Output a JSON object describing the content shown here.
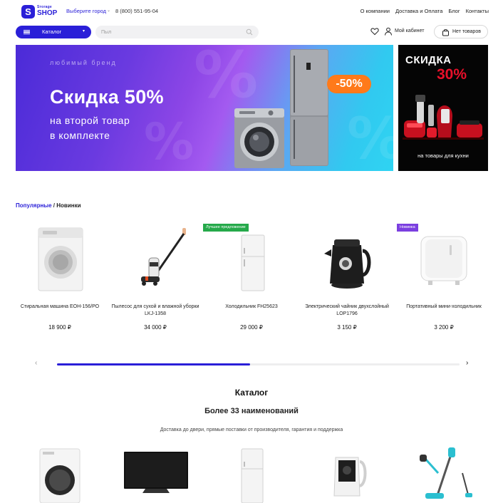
{
  "header": {
    "logo_top": "Sтorage",
    "logo_bottom": "SHOP",
    "logo_badge": "S",
    "city": "Выберите город",
    "phone": "8 (800) 551-95-04",
    "nav": [
      "О компании",
      "Доставка и Оплата",
      "Блог",
      "Контакты"
    ]
  },
  "search": {
    "catalog_label": "Каталог",
    "placeholder": "Пыл",
    "cabinet_label": "Мой кабинет",
    "cart_label": "Нет товаров"
  },
  "banner_main": {
    "brand": "любимый бренд",
    "headline": "Скидка 50%",
    "line1": "на второй товар",
    "line2": "в комплекте",
    "discount": "-50%",
    "bg_symbol": "%"
  },
  "banner_side": {
    "title": "СКИДКА",
    "percent": "30%",
    "footer": "на товары для кухни"
  },
  "tabs": {
    "popular": "Популярные",
    "separator": " / ",
    "new": "Новинки"
  },
  "products": [
    {
      "name": "Стиральная машина ЕОН-156/РО",
      "price": "18 900 ₽",
      "badge": ""
    },
    {
      "name": "Пылесос для сухой и влажной уборки LKJ-1358",
      "price": "34 000 ₽",
      "badge": ""
    },
    {
      "name": "Холодильник FH25623",
      "price": "29 000 ₽",
      "badge": "Лучшее предложение"
    },
    {
      "name": "Электрический чайник двухслойный LOP1796",
      "price": "3 150 ₽",
      "badge": ""
    },
    {
      "name": "Портативный мини-холодильник",
      "price": "3 200 ₽",
      "badge": "Новинка"
    }
  ],
  "slider": {
    "progress": 0.48
  },
  "catalog": {
    "title": "Каталог",
    "subtitle": "Более 33 наименований",
    "description": "Доставка до двери, прямые поставки от производителя, гарантия и поддержка"
  },
  "colors": {
    "accent": "#2a1fd8",
    "badge_best": "#25a94a",
    "badge_new": "#7b3fe0",
    "sale_orange": "#ff7a1a",
    "sale_red": "#e8102a"
  }
}
